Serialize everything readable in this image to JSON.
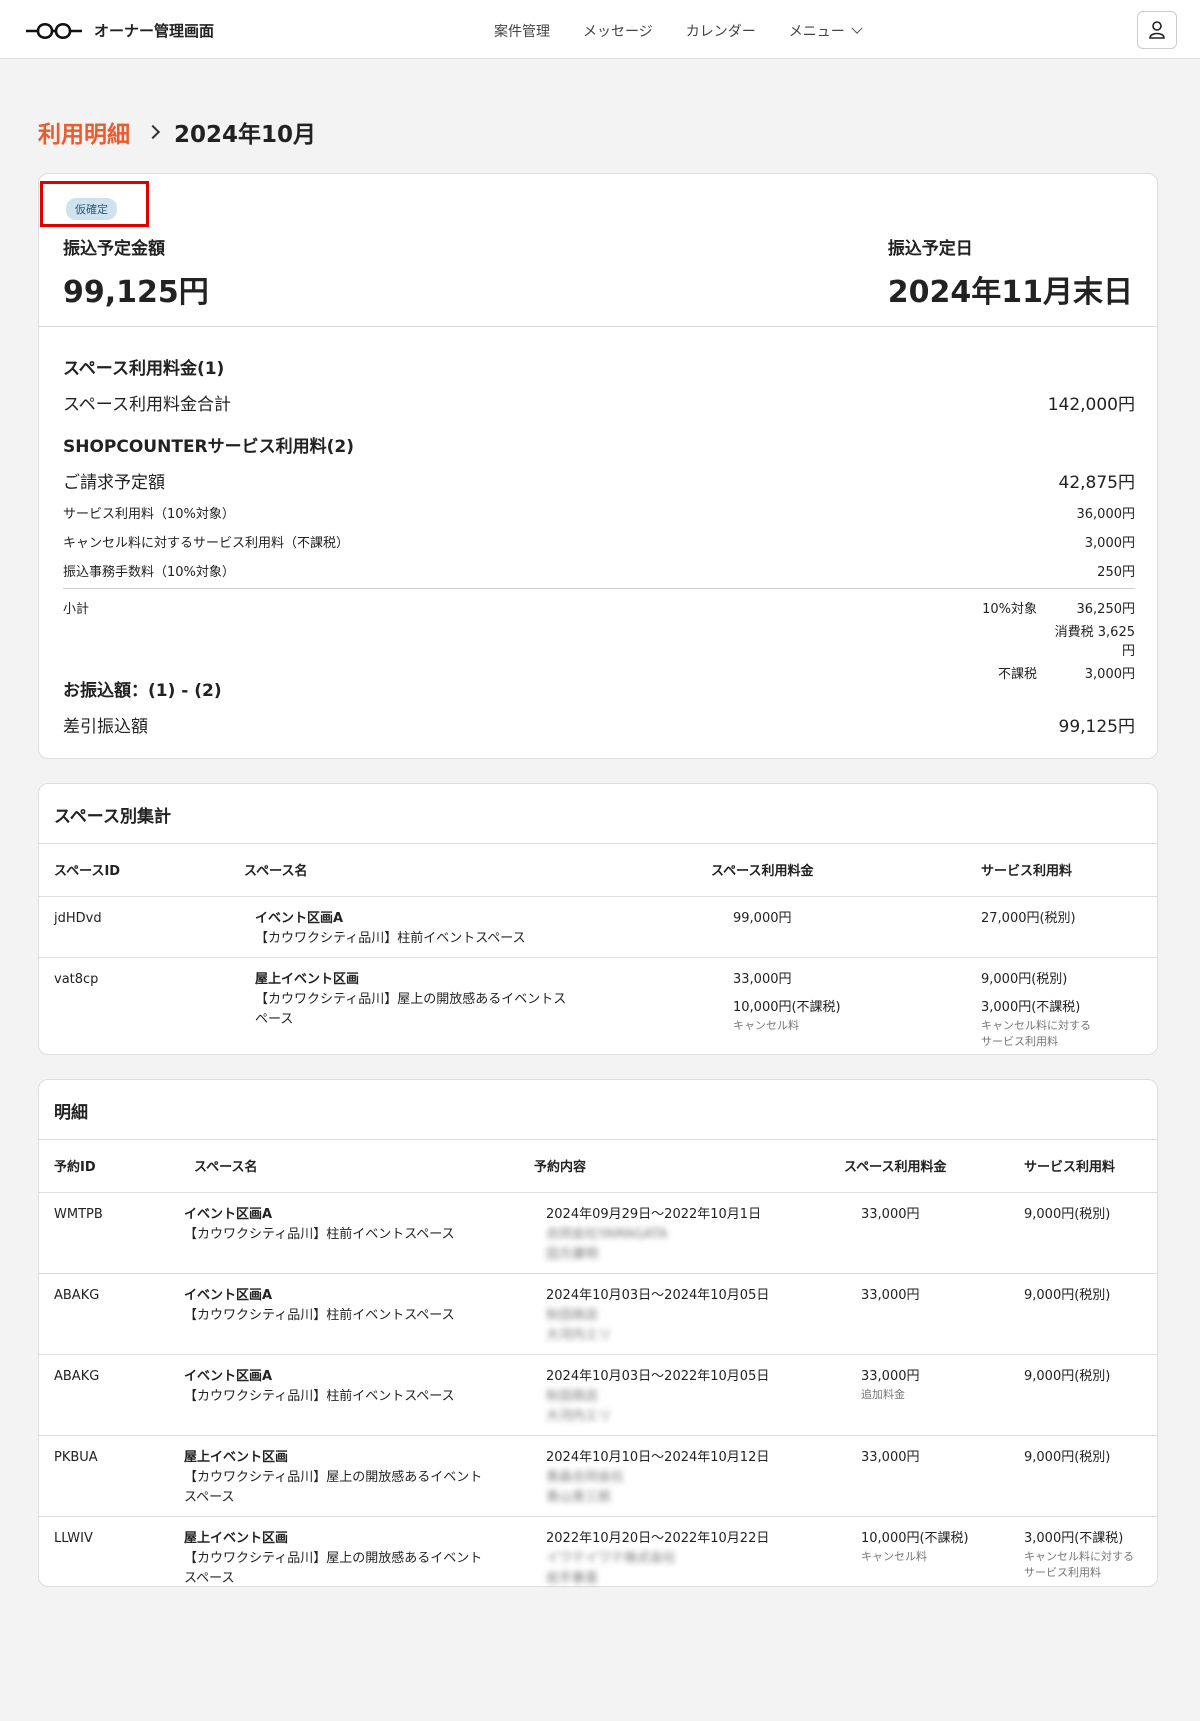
{
  "header": {
    "title": "オーナー管理画面",
    "nav": [
      "案件管理",
      "メッセージ",
      "カレンダー",
      "メニュー"
    ]
  },
  "breadcrumb": {
    "parent": "利用明細",
    "current": "2024年10月"
  },
  "summary": {
    "status_badge": "仮確定",
    "amount_label": "振込予定金額",
    "amount_value": "99,125円",
    "date_label": "振込予定日",
    "date_value": "2024年11月末日"
  },
  "breakdown": {
    "space_heading": "スペース利用料金(1)",
    "space_total_label": "スペース利用料金合計",
    "space_total_value": "142,000円",
    "service_heading": "SHOPCOUNTERサービス利用料(2)",
    "billing_label": "ご請求予定額",
    "billing_value": "42,875円",
    "items": [
      {
        "label": "サービス利用料（10%対象）",
        "value": "36,000円"
      },
      {
        "label": "キャンセル料に対するサービス利用料（不課税）",
        "value": "3,000円"
      },
      {
        "label": "振込事務手数料（10%対象）",
        "value": "250円"
      }
    ],
    "subtotal_label": "小計",
    "subtotal": [
      {
        "label": "10%対象",
        "value": "36,250円"
      },
      {
        "label": "",
        "value": "消費税 3,625円"
      },
      {
        "label": "不課税",
        "value": "3,000円"
      }
    ],
    "transfer_heading": "お振込額：(1) - (2)",
    "transfer_label": "差引振込額",
    "transfer_value": "99,125円"
  },
  "space_summary": {
    "title": "スペース別集計",
    "columns": [
      "スペースID",
      "スペース名",
      "スペース利用料金",
      "サービス利用料"
    ],
    "rows": [
      {
        "id": "jdHDvd",
        "name": "イベント区画A",
        "desc": "【カウワクシティ品川】柱前イベントスペース",
        "fee": "99,000円",
        "fee2": "",
        "fee2_note": "",
        "svc": "27,000円(税別)",
        "svc2": "",
        "svc2_note": ""
      },
      {
        "id": "vat8cp",
        "name": "屋上イベント区画",
        "desc": "【カウワクシティ品川】屋上の開放感あるイベントスペース",
        "fee": "33,000円",
        "fee2": "10,000円(不課税)",
        "fee2_note": "キャンセル料",
        "svc": "9,000円(税別)",
        "svc2": "3,000円(不課税)",
        "svc2_note": "キャンセル料に対するサービス利用料"
      }
    ]
  },
  "details": {
    "title": "明細",
    "columns": [
      "予約ID",
      "スペース名",
      "予約内容",
      "スペース利用料金",
      "サービス利用料"
    ],
    "rows": [
      {
        "id": "WMTPB",
        "name": "イベント区画A",
        "desc": "【カウワクシティ品川】柱前イベントスペース",
        "period": "2024年09月29日〜2022年10月1日",
        "b1": "合同会社YAMAGATA",
        "b2": "田方康明",
        "fee": "33,000円",
        "fee_note": "",
        "svc": "9,000円(税別)",
        "svc_note": ""
      },
      {
        "id": "ABAKG",
        "name": "イベント区画A",
        "desc": "【カウワクシティ品川】柱前イベントスペース",
        "period": "2024年10月03日〜2024年10月05日",
        "b1": "秋田商店",
        "b2": "大河内エリ",
        "fee": "33,000円",
        "fee_note": "",
        "svc": "9,000円(税別)",
        "svc_note": ""
      },
      {
        "id": "ABAKG",
        "name": "イベント区画A",
        "desc": "【カウワクシティ品川】柱前イベントスペース",
        "period": "2024年10月03日〜2022年10月05日",
        "b1": "秋田商店",
        "b2": "大河内エリ",
        "fee": "33,000円",
        "fee_note": "追加料金",
        "svc": "9,000円(税別)",
        "svc_note": ""
      },
      {
        "id": "PKBUA",
        "name": "屋上イベント区画",
        "desc": "【カウワクシティ品川】屋上の開放感あるイベントスペース",
        "period": "2024年10月10日〜2024年10月12日",
        "b1": "青森合同会社",
        "b2": "青山青三郎",
        "fee": "33,000円",
        "fee_note": "",
        "svc": "9,000円(税別)",
        "svc_note": ""
      },
      {
        "id": "LLWIV",
        "name": "屋上イベント区画",
        "desc": "【カウワクシティ品川】屋上の開放感あるイベントスペース",
        "period": "2022年10月20日〜2022年10月22日",
        "b1": "イワテイワテ株式会社",
        "b2": "岩手春喜",
        "fee": "10,000円(不課税)",
        "fee_note": "キャンセル料",
        "svc": "3,000円(不課税)",
        "svc_note": "キャンセル料に対するサービス利用料"
      }
    ]
  }
}
